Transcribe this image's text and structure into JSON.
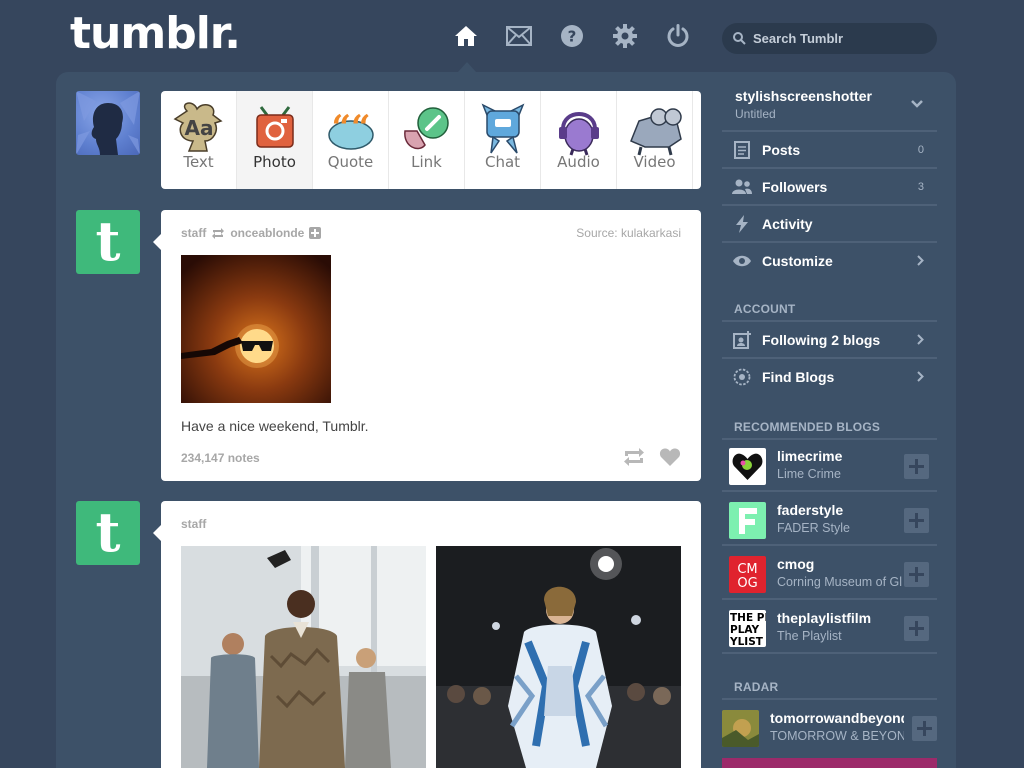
{
  "header": {
    "logo": "tumblr.",
    "nav": [
      {
        "name": "home-icon"
      },
      {
        "name": "inbox-icon"
      },
      {
        "name": "help-icon"
      },
      {
        "name": "settings-icon"
      },
      {
        "name": "logout-icon"
      }
    ],
    "search_placeholder": "Search Tumblr"
  },
  "post_types": [
    {
      "label": "Text",
      "icon": "text-post-icon"
    },
    {
      "label": "Photo",
      "icon": "photo-post-icon"
    },
    {
      "label": "Quote",
      "icon": "quote-post-icon"
    },
    {
      "label": "Link",
      "icon": "link-post-icon"
    },
    {
      "label": "Chat",
      "icon": "chat-post-icon"
    },
    {
      "label": "Audio",
      "icon": "audio-post-icon"
    },
    {
      "label": "Video",
      "icon": "video-post-icon"
    }
  ],
  "posts": [
    {
      "author": "staff",
      "reblogged_from": "onceablonde",
      "source": "Source: kulakarkasi",
      "caption": "Have a nice weekend, Tumblr.",
      "notes": "234,147 notes"
    },
    {
      "author": "staff"
    }
  ],
  "sidebar": {
    "blog": {
      "name": "stylishscreenshotter",
      "title": "Untitled"
    },
    "items": [
      {
        "label": "Posts",
        "count": "0",
        "icon": "posts-icon"
      },
      {
        "label": "Followers",
        "count": "3",
        "icon": "followers-icon"
      },
      {
        "label": "Activity",
        "icon": "activity-icon"
      },
      {
        "label": "Customize",
        "icon": "eye-icon"
      }
    ],
    "account_head": "ACCOUNT",
    "account_items": [
      {
        "label": "Following 2 blogs",
        "icon": "following-icon"
      },
      {
        "label": "Find Blogs",
        "icon": "compass-icon"
      }
    ],
    "recommended_head": "RECOMMENDED BLOGS",
    "recommended": [
      {
        "name": "limecrime",
        "title": "Lime Crime"
      },
      {
        "name": "faderstyle",
        "title": "FADER Style"
      },
      {
        "name": "cmog",
        "title": "Corning Museum of Glass"
      },
      {
        "name": "theplaylistfilm",
        "title": "The Playlist"
      }
    ],
    "radar_head": "RADAR",
    "radar": {
      "name": "tomorrowandbeyond",
      "title": "TOMORROW & BEYOND"
    }
  },
  "colors": {
    "background": "#36465d",
    "container": "#3d5168",
    "staff_green": "#3fb97b"
  }
}
